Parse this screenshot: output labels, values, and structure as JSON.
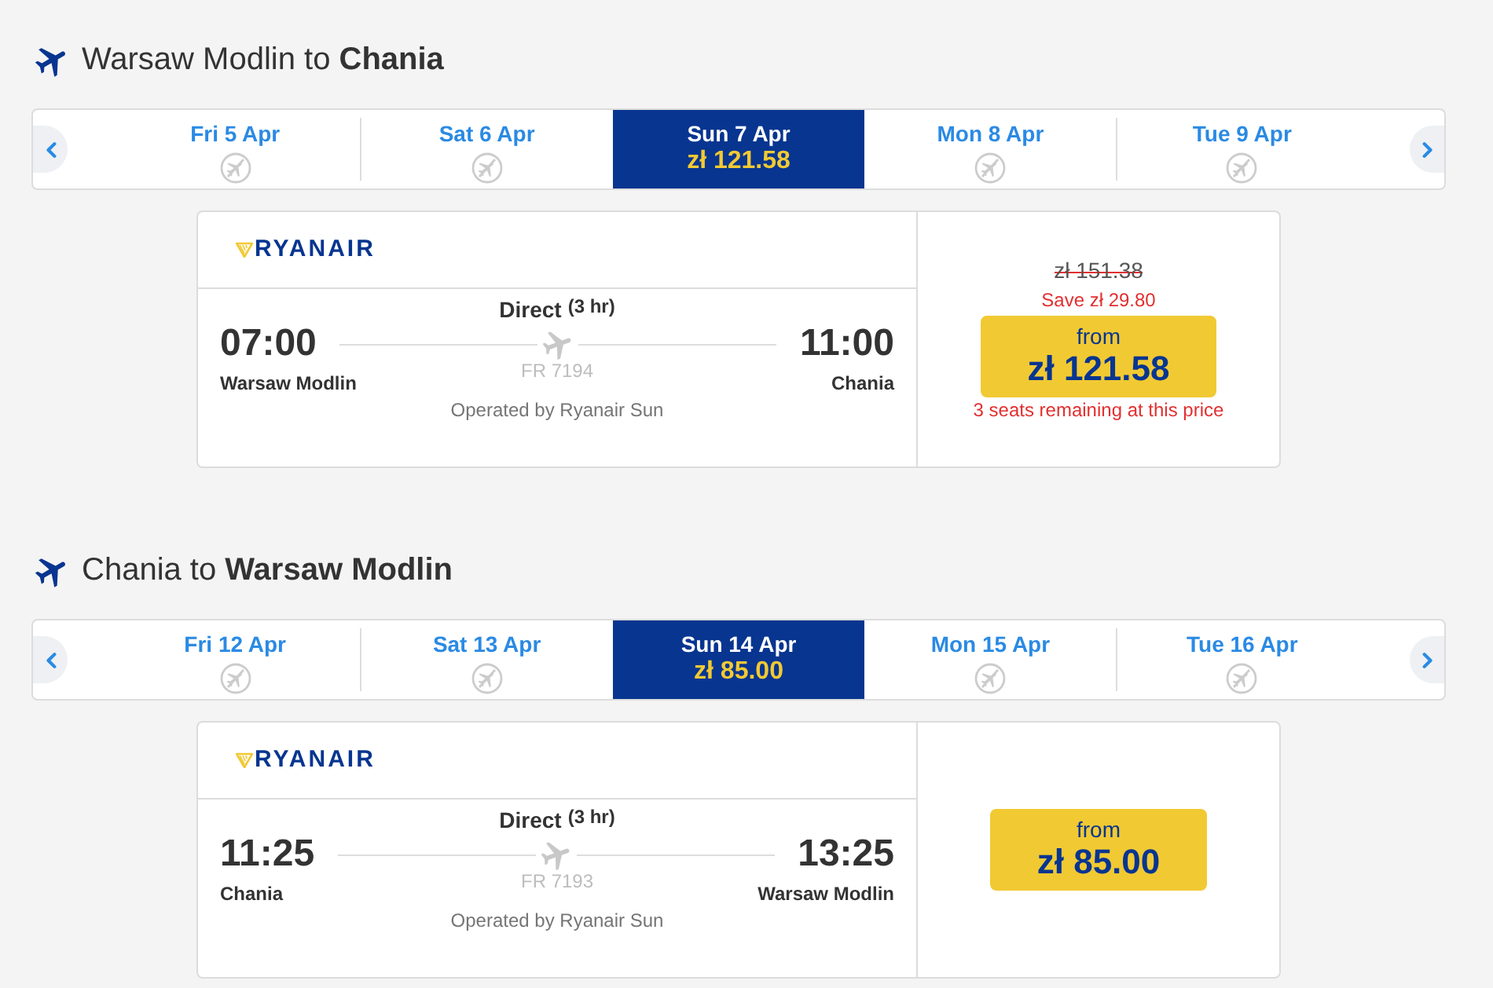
{
  "journeys": [
    {
      "title": "Warsaw Modlin to **Chania**",
      "dates": [
        {
          "label": "Fri 5 Apr",
          "selected": false
        },
        {
          "label": "Sat 6 Apr",
          "selected": false
        },
        {
          "label": "Sun 7 Apr",
          "selected": true,
          "price": "zł 121.58"
        },
        {
          "label": "Mon 8 Apr",
          "selected": false
        },
        {
          "label": "Tue 9 Apr",
          "selected": false
        }
      ],
      "flight": {
        "airline": "RYANAIR",
        "stops": "Direct",
        "duration": "(3 hr)",
        "departure_time": "07:00",
        "arrival_time": "11:00",
        "flight_number": "FR 7194",
        "departure_airport": "Warsaw Modlin",
        "arrival_airport": "Chania",
        "operator": "Operated by Ryanair Sun",
        "original_price": "zł 151.38",
        "saving": "Save zł 29.80",
        "price_label": "from",
        "price": "zł 121.58",
        "seats_note": "3 seats remaining at this price"
      }
    },
    {
      "title": "Chania to **Warsaw Modlin**",
      "dates": [
        {
          "label": "Fri 12 Apr",
          "selected": false
        },
        {
          "label": "Sat 13 Apr",
          "selected": false
        },
        {
          "label": "Sun 14 Apr",
          "selected": true,
          "price": "zł 85.00"
        },
        {
          "label": "Mon 15 Apr",
          "selected": false
        },
        {
          "label": "Tue 16 Apr",
          "selected": false
        }
      ],
      "flight": {
        "airline": "RYANAIR",
        "stops": "Direct",
        "duration": "(3 hr)",
        "departure_time": "11:25",
        "arrival_time": "13:25",
        "flight_number": "FR 7193",
        "departure_airport": "Chania",
        "arrival_airport": "Warsaw Modlin",
        "operator": "Operated by Ryanair Sun",
        "price_label": "from",
        "price": "zł 85.00"
      }
    }
  ]
}
